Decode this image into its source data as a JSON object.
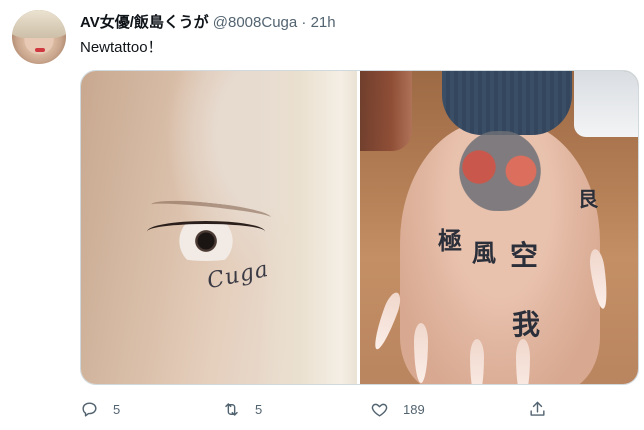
{
  "tweet": {
    "display_name": "AV女優/飯島くうが",
    "handle": "@8008Cuga",
    "separator": "·",
    "time": "21h",
    "text": "Newtattoo！",
    "media": {
      "left_tattoo_text": "Cuga",
      "right_kanji": [
        "極",
        "風",
        "空",
        "我",
        "艮"
      ]
    },
    "actions": {
      "reply_count": "5",
      "retweet_count": "5",
      "like_count": "189"
    }
  },
  "icons": {
    "reply": "reply-icon",
    "retweet": "retweet-icon",
    "like": "heart-icon",
    "share": "share-icon"
  },
  "colors": {
    "text": "#0f1419",
    "secondary": "#536471",
    "border": "#cfd9de"
  }
}
